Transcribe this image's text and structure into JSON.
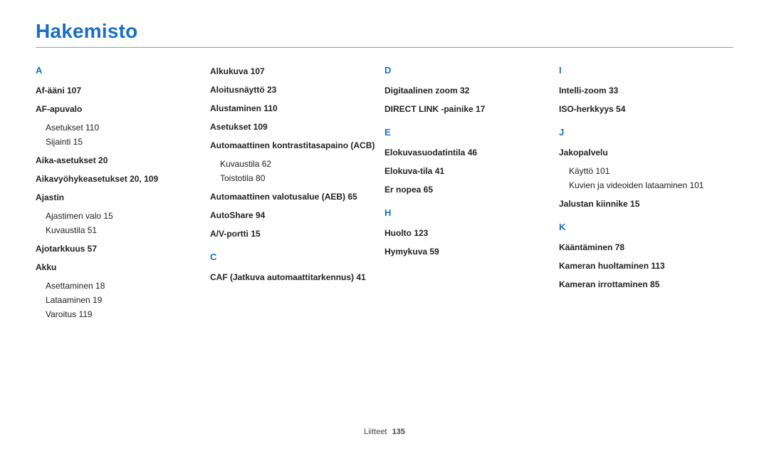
{
  "title": "Hakemisto",
  "footer": {
    "label": "Liitteet",
    "page": "135"
  },
  "columns": [
    {
      "sections": [
        {
          "letter": "A",
          "entries": [
            {
              "label": "Af-ääni  107"
            },
            {
              "label": "AF-apuvalo",
              "subs": [
                "Asetukset  110",
                "Sijainti  15"
              ]
            },
            {
              "label": "Aika-asetukset  20"
            },
            {
              "label": "Aikavyöhykeasetukset  20, 109"
            },
            {
              "label": "Ajastin",
              "subs": [
                "Ajastimen valo  15",
                "Kuvaustila  51"
              ]
            },
            {
              "label": "Ajotarkkuus  57"
            },
            {
              "label": "Akku",
              "subs": [
                "Asettaminen  18",
                "Lataaminen  19",
                "Varoitus  119"
              ]
            }
          ]
        }
      ]
    },
    {
      "sections": [
        {
          "letter": null,
          "entries": [
            {
              "label": "Alkukuva  107"
            },
            {
              "label": "Aloitusnäyttö  23"
            },
            {
              "label": "Alustaminen  110"
            },
            {
              "label": "Asetukset  109"
            },
            {
              "label": "Automaattinen kontrastitasapaino (ACB)",
              "subs": [
                "Kuvaustila  62",
                "Toistotila  80"
              ]
            },
            {
              "label": "Automaattinen valotusalue (AEB)  65"
            },
            {
              "label": "AutoShare  94"
            },
            {
              "label": "A/V-portti  15"
            }
          ]
        },
        {
          "letter": "C",
          "entries": [
            {
              "label": "CAF (Jatkuva automaattitarkennus)  41"
            }
          ]
        }
      ]
    },
    {
      "sections": [
        {
          "letter": "D",
          "entries": [
            {
              "label": "Digitaalinen zoom  32"
            },
            {
              "label": "DIRECT LINK -painike  17"
            }
          ]
        },
        {
          "letter": "E",
          "entries": [
            {
              "label": "Elokuvasuodatintila  46"
            },
            {
              "label": "Elokuva-tila  41"
            },
            {
              "label": "Er nopea  65"
            }
          ]
        },
        {
          "letter": "H",
          "entries": [
            {
              "label": "Huolto  123"
            },
            {
              "label": "Hymykuva  59"
            }
          ]
        }
      ]
    },
    {
      "sections": [
        {
          "letter": "I",
          "entries": [
            {
              "label": "Intelli-zoom  33"
            },
            {
              "label": "ISO-herkkyys  54"
            }
          ]
        },
        {
          "letter": "J",
          "entries": [
            {
              "label": "Jakopalvelu",
              "subs": [
                "Käyttö  101",
                "Kuvien ja videoiden lataaminen  101"
              ]
            },
            {
              "label": "Jalustan kiinnike  15"
            }
          ]
        },
        {
          "letter": "K",
          "entries": [
            {
              "label": "Kääntäminen  78"
            },
            {
              "label": "Kameran huoltaminen  113"
            },
            {
              "label": "Kameran irrottaminen  85"
            }
          ]
        }
      ]
    }
  ]
}
